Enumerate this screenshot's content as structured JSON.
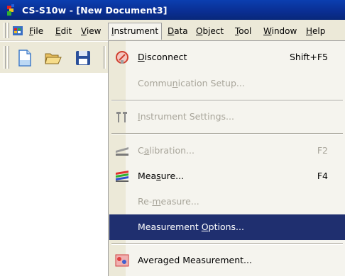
{
  "window": {
    "title": "CS-S10w - [New Document3]"
  },
  "menubar": {
    "items": [
      {
        "label": "File",
        "mnemonic": "F",
        "rest": "ile"
      },
      {
        "label": "Edit",
        "mnemonic": "E",
        "rest": "dit"
      },
      {
        "label": "View",
        "mnemonic": "V",
        "rest": "iew"
      },
      {
        "label": "Instrument",
        "mnemonic": "I",
        "rest": "nstrument"
      },
      {
        "label": "Data",
        "mnemonic": "D",
        "rest": "ata"
      },
      {
        "label": "Object",
        "mnemonic": "O",
        "rest": "bject"
      },
      {
        "label": "Tool",
        "mnemonic": "T",
        "rest": "ool"
      },
      {
        "label": "Window",
        "mnemonic": "W",
        "rest": "indow"
      },
      {
        "label": "Help",
        "mnemonic": "H",
        "rest": "elp"
      }
    ]
  },
  "toolbar": {
    "buttons": [
      {
        "icon": "new-document-icon"
      },
      {
        "icon": "open-folder-icon"
      },
      {
        "icon": "save-disk-icon"
      }
    ]
  },
  "dropdown": {
    "items": [
      {
        "pre": "",
        "mnemonic": "D",
        "post": "isconnect",
        "shortcut": "Shift+F5",
        "enabled": true,
        "icon": "disconnect-icon"
      },
      {
        "pre": "Commu",
        "mnemonic": "n",
        "post": "ication Setup...",
        "shortcut": "",
        "enabled": false,
        "icon": ""
      },
      {
        "pre": "",
        "mnemonic": "I",
        "post": "nstrument Settings...",
        "shortcut": "",
        "enabled": false,
        "icon": "instrument-settings-icon"
      },
      {
        "pre": "C",
        "mnemonic": "a",
        "post": "libration...",
        "shortcut": "F2",
        "enabled": false,
        "icon": "calibration-icon"
      },
      {
        "pre": "Mea",
        "mnemonic": "s",
        "post": "ure...",
        "shortcut": "F4",
        "enabled": true,
        "icon": "measure-icon"
      },
      {
        "pre": "Re-",
        "mnemonic": "m",
        "post": "easure...",
        "shortcut": "",
        "enabled": false,
        "icon": ""
      },
      {
        "pre": "Measurement ",
        "mnemonic": "O",
        "post": "ptions...",
        "shortcut": "",
        "enabled": true,
        "icon": "",
        "highlighted": true
      },
      {
        "pre": "Averaged Measurement...",
        "mnemonic": "",
        "post": "",
        "shortcut": "",
        "enabled": true,
        "icon": "averaged-measurement-icon"
      }
    ]
  },
  "colors": {
    "titlebar": "#0a2f94",
    "highlight": "#1f2f6f",
    "disabled_text": "#a8a59a",
    "menu_bg": "#ece9d8"
  }
}
